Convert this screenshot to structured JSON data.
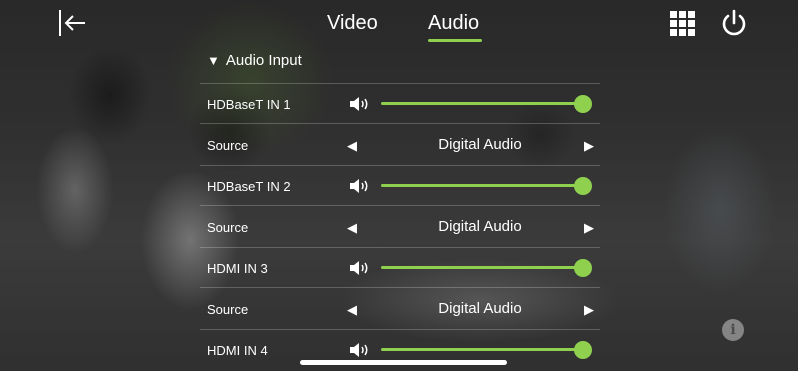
{
  "header": {
    "tabs": [
      {
        "label": "Video",
        "active": false
      },
      {
        "label": "Audio",
        "active": true
      }
    ],
    "icons": {
      "back": "back-arrow-icon",
      "grid": "grid-menu-icon",
      "power": "power-icon"
    }
  },
  "section": {
    "title": "Audio Input",
    "expanded": true
  },
  "inputs": [
    {
      "label": "HDBaseT IN 1",
      "volume_fraction": 1.0,
      "source_label": "Source",
      "source_value": "Digital Audio"
    },
    {
      "label": "HDBaseT IN 2",
      "volume_fraction": 1.0,
      "source_label": "Source",
      "source_value": "Digital Audio"
    },
    {
      "label": "HDMI IN 3",
      "volume_fraction": 1.0,
      "source_label": "Source",
      "source_value": "Digital Audio"
    },
    {
      "label": "HDMI IN 4",
      "volume_fraction": 1.0
    }
  ],
  "colors": {
    "accent": "#8fd14f",
    "text": "#ffffff"
  },
  "info_icon": "info-icon"
}
